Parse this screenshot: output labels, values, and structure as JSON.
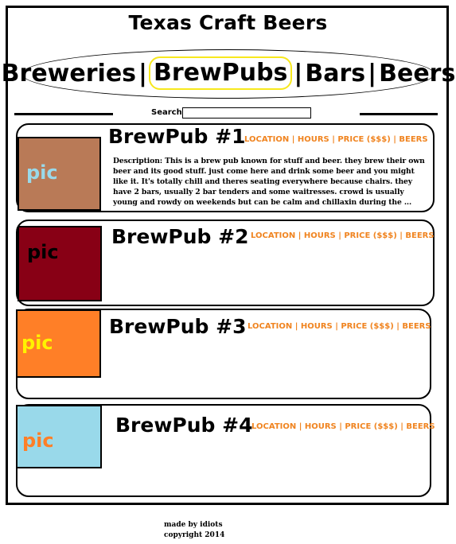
{
  "site": {
    "title": "Texas Craft Beers"
  },
  "nav": {
    "items": [
      {
        "label": "Breweries"
      },
      {
        "label": "BrewPubs",
        "active": true
      },
      {
        "label": "Bars"
      },
      {
        "label": "Beers"
      }
    ],
    "separator": "|"
  },
  "search": {
    "label": "Search:",
    "value": ""
  },
  "pubs": [
    {
      "title": "BrewPub #1",
      "pic_label": "pic",
      "pic_color": "#b97a57",
      "pic_text_color": "#99d9ea",
      "links": "LOCATION | HOURS | PRICE ($$$) | BEERS",
      "description": "Description: This is a brew pub known for stuff and beer. they brew their own beer and its good stuff. just come here and drink some beer and you might like it. It's totally chill and theres seating everywhere because chairs. they have 2 bars, usually 2 bar tenders and some waitresses. crowd is usually young and rowdy on weekends but can be calm and chillaxin during the ..."
    },
    {
      "title": "BrewPub #2",
      "pic_label": "pic",
      "pic_color": "#880015",
      "pic_text_color": "#000000",
      "links": "LOCATION | HOURS | PRICE ($$$) | BEERS"
    },
    {
      "title": "BrewPub #3",
      "pic_label": "pic",
      "pic_color": "#ff7f27",
      "pic_text_color": "#fff200",
      "links": "LOCATION | HOURS | PRICE ($$$) | BEERS"
    },
    {
      "title": "BrewPub #4",
      "pic_label": "pic",
      "pic_color": "#99d9ea",
      "pic_text_color": "#ff7f27",
      "links": "LOCATION | HOURS | PRICE ($$$) | BEERS"
    }
  ],
  "footer": {
    "line1": "made by idiots",
    "line2": "copyright 2014"
  },
  "colors": {
    "accent_link": "#f08420",
    "nav_highlight": "#f7e81c"
  }
}
